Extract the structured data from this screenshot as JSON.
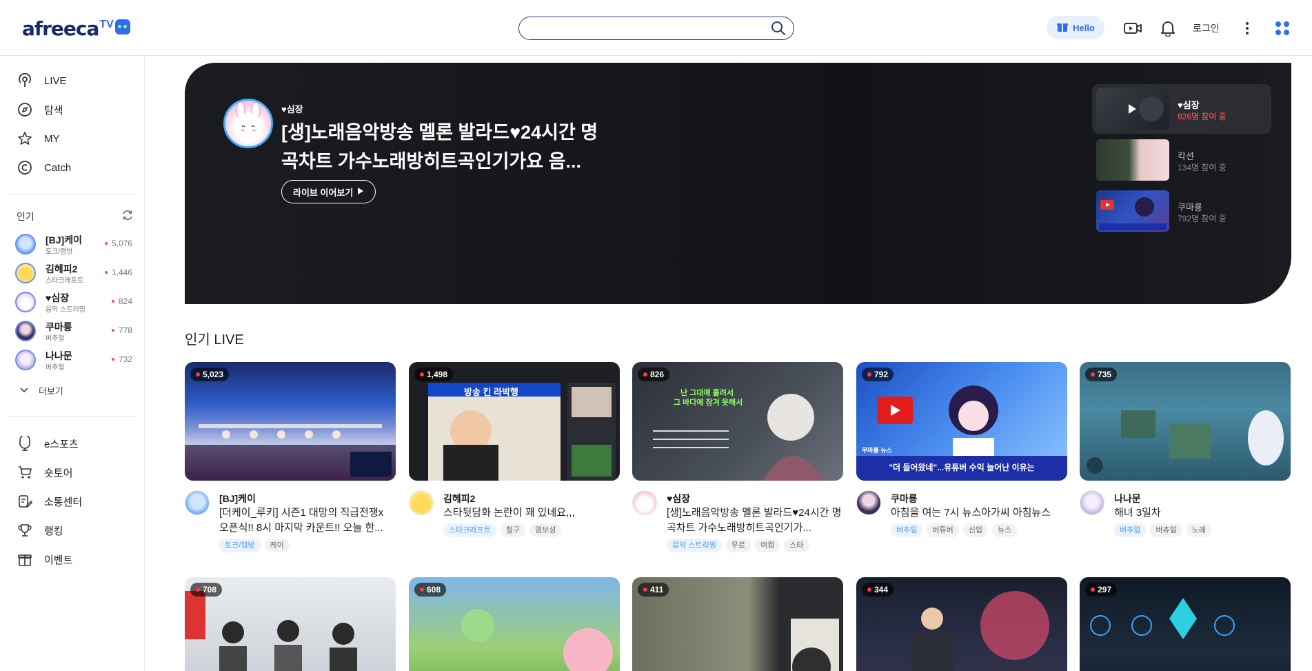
{
  "header": {
    "logo_text": "afreeca",
    "logo_tv": "TV",
    "search_placeholder": "",
    "hello_label": "Hello",
    "login_label": "로그인"
  },
  "sidebar": {
    "nav": [
      {
        "label": "LIVE",
        "icon": "live-broadcast-icon"
      },
      {
        "label": "탐색",
        "icon": "explore-compass-icon"
      },
      {
        "label": "MY",
        "icon": "star-icon"
      },
      {
        "label": "Catch",
        "icon": "catch-icon"
      }
    ],
    "popular_title": "인기",
    "popular": [
      {
        "name": "[BJ]케이",
        "category": "토크/캠방",
        "viewers": "5,076"
      },
      {
        "name": "김헤피2",
        "category": "스타크래프트",
        "viewers": "1,446"
      },
      {
        "name": "♥심장",
        "category": "음악 스트리밍",
        "viewers": "824"
      },
      {
        "name": "쿠마룡",
        "category": "버추얼",
        "viewers": "778"
      },
      {
        "name": "나나문",
        "category": "버추얼",
        "viewers": "732"
      }
    ],
    "more_label": "더보기",
    "bottom_nav": [
      {
        "label": "e스포츠",
        "icon": "esports-icon"
      },
      {
        "label": "숏토어",
        "icon": "shopping-cart-icon"
      },
      {
        "label": "소통센터",
        "icon": "edit-note-icon"
      },
      {
        "label": "랭킹",
        "icon": "trophy-icon"
      },
      {
        "label": "이벤트",
        "icon": "gift-icon"
      }
    ]
  },
  "banner": {
    "streamer": "♥심장",
    "title": "[생]노래음악방송 멜론 발라드♥24시간 명곡차트 가수노래방히트곡인기가요 음...",
    "cta": "라이브 이어보기",
    "side": [
      {
        "name": "♥심장",
        "viewers": "826명 참여 중"
      },
      {
        "name": "칵션",
        "viewers": "134명 참여 중"
      },
      {
        "name": "쿠마룡",
        "viewers": "792명 참여 중"
      }
    ]
  },
  "section_title": "인기 LIVE",
  "cards": [
    {
      "viewers": "5,023",
      "name": "[BJ]케이",
      "title": "[더케이_루키] 시즌1 대망의 직급전쟁x 오픈식!! 8시 마지막 카운트!! 오늘 한...",
      "tags": [
        "토크/캠방",
        "케이"
      ]
    },
    {
      "viewers": "1,498",
      "name": "김헤피2",
      "title": "스타뒷담화 논란이 꽤 있네요,,,",
      "tags": [
        "스타크래프트",
        "철구",
        "염보성"
      ]
    },
    {
      "viewers": "826",
      "name": "♥심장",
      "title": "[생]노래음악방송 멜론 발라드♥24시간 명곡차트 가수노래방히트곡인기가...",
      "tags": [
        "음악 스트리밍",
        "무료",
        "여캠",
        "스타"
      ]
    },
    {
      "viewers": "792",
      "name": "쿠마룡",
      "title": "아침을 여는 7시 뉴스아가씨 아침뉴스",
      "tags": [
        "버추얼",
        "버튜버",
        "신입",
        "뉴스"
      ]
    },
    {
      "viewers": "735",
      "name": "나나문",
      "title": "해녀 3일차",
      "tags": [
        "버추얼",
        "버츄얼",
        "노래"
      ]
    }
  ],
  "cards_row2": [
    {
      "viewers": "708"
    },
    {
      "viewers": "608"
    },
    {
      "viewers": "411"
    },
    {
      "viewers": "344"
    },
    {
      "viewers": "297"
    }
  ],
  "thumb_text": {
    "card2_banner": "방송 킨 라박행",
    "card3_line1": "난 그대에 홀려서",
    "card3_line2": "그 바다에 잠겨 못해서",
    "card4_caption": "\"더 들어왔네\"...유튜버 수익 늘어난 이유는",
    "card4_label": "쿠마룡 뉴스"
  },
  "colors": {
    "accent": "#2f6cf6",
    "live_dot": "#ff3b3b",
    "banner_bg": "#121317"
  }
}
